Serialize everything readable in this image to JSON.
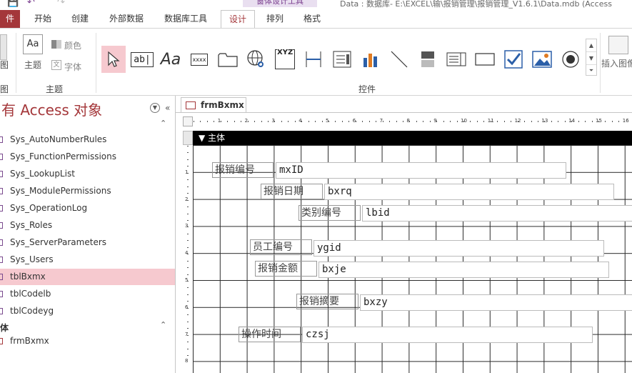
{
  "window": {
    "context_tab_group": "窗体设计工具",
    "title": "Data : 数据库- E:\\EXCEL\\输\\报销管理\\报销管理_V1.6.1\\Data.mdb (Access"
  },
  "tabs": [
    {
      "label": "件"
    },
    {
      "label": "开始"
    },
    {
      "label": "创建"
    },
    {
      "label": "外部数据"
    },
    {
      "label": "数据库工具"
    },
    {
      "label": "设计"
    },
    {
      "label": "排列"
    },
    {
      "label": "格式"
    }
  ],
  "ribbon": {
    "view_group_label": "图",
    "view_label": "图",
    "theme_group_label": "主题",
    "theme_label": "主题",
    "colors_label": "颜色",
    "fonts_label": "字体",
    "controls_group_label": "控件",
    "insert_image_label": "插入图像",
    "label_glyph": "Aa",
    "textbox_glyph": "ab|",
    "button_glyph": "xxxx",
    "xyz_glyph": "XYZ"
  },
  "nav": {
    "title": "有 Access 对象",
    "tables": [
      {
        "label": "Sys_AutoNumberRules"
      },
      {
        "label": "Sys_FunctionPermissions"
      },
      {
        "label": "Sys_LookupList"
      },
      {
        "label": "Sys_ModulePermissions"
      },
      {
        "label": "Sys_OperationLog"
      },
      {
        "label": "Sys_Roles"
      },
      {
        "label": "Sys_ServerParameters"
      },
      {
        "label": "Sys_Users"
      },
      {
        "label": "tblBxmx"
      },
      {
        "label": "tblCodelb"
      },
      {
        "label": "tblCodeyg"
      }
    ],
    "forms_header": "体",
    "forms": [
      {
        "label": "frmBxmx"
      }
    ]
  },
  "document": {
    "tab_label": "frmBxmx",
    "section_label": "主体",
    "ruler_marks": [
      "1",
      "2",
      "3",
      "4",
      "5",
      "6",
      "7",
      "8",
      "9",
      "10",
      "11",
      "12",
      "13",
      "14",
      "15",
      "16"
    ],
    "vruler_marks": [
      "1",
      "2",
      "3",
      "4",
      "5",
      "6",
      "7",
      "8"
    ],
    "fields": [
      {
        "label": "报销编号",
        "control": "mxID"
      },
      {
        "label": "报销日期",
        "control": "bxrq"
      },
      {
        "label": "类别编号",
        "control": "lbid"
      },
      {
        "label": "员工编号",
        "control": "ygid"
      },
      {
        "label": "报销金额",
        "control": "bxje"
      },
      {
        "label": "报销摘要",
        "control": "bxzy"
      },
      {
        "label": "操作时间",
        "control": "czsj"
      }
    ]
  },
  "colors": {
    "accent": "#a4373a",
    "selected_bg": "#f6c9cf"
  }
}
